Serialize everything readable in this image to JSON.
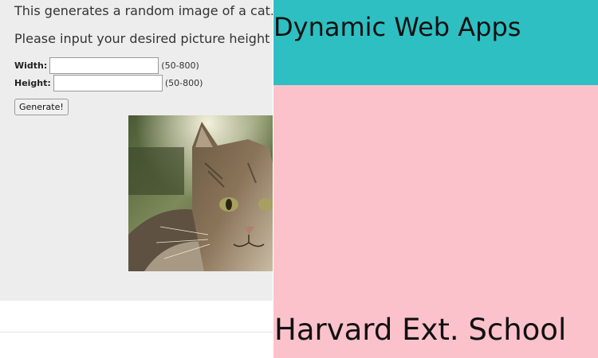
{
  "app": {
    "intro_text": "This generates a random image of a cat.",
    "instruction_text": "Please input your desired picture height and"
  },
  "form": {
    "width_label": "Width:",
    "width_value": "",
    "width_range": "(50-800)",
    "height_label": "Height:",
    "height_value": "",
    "height_range": "(50-800)",
    "generate_label": "Generate!"
  },
  "image": {
    "alt": "cat photo"
  },
  "header": {
    "title": "Dynamic Web Apps"
  },
  "footer": {
    "school": "Harvard Ext. School"
  },
  "colors": {
    "header_bg": "#2ebfc2",
    "pink_bg": "#fcc2cb",
    "left_bg": "#ededed"
  }
}
